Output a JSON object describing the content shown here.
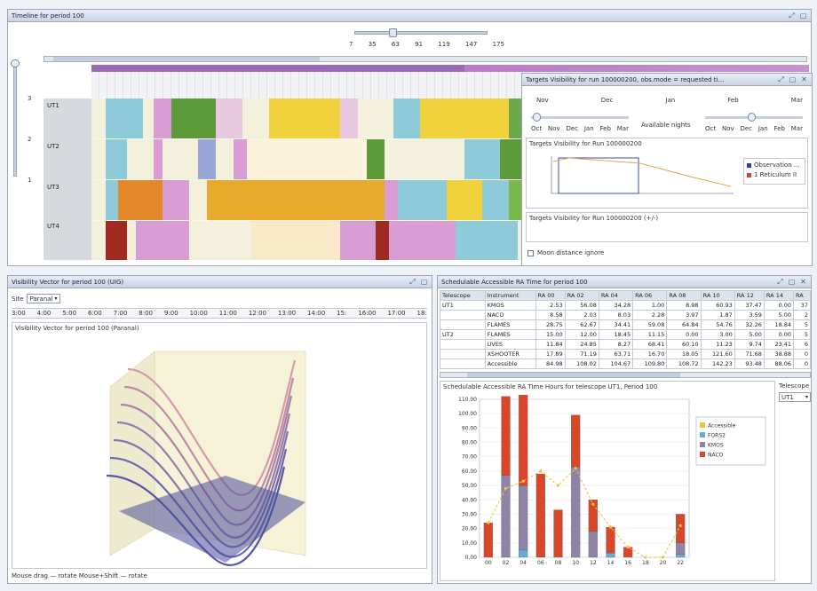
{
  "timeline": {
    "title": "Timeline for period 100",
    "slider_ticks": [
      "7",
      "35",
      "63",
      "91",
      "119",
      "147",
      "175"
    ],
    "telescopes": [
      "UT1",
      "UT2",
      "UT3",
      "UT4"
    ],
    "row_numbers": [
      "3",
      "2",
      "1"
    ]
  },
  "targets": {
    "title": "Targets Visibility for run 100000200, obs.mode = requested ti...",
    "months": [
      "Nov",
      "Dec",
      "Jan",
      "Feb",
      "Mar"
    ],
    "left_scale": [
      "Oct",
      "Nov",
      "Dec",
      "Jan",
      "Feb",
      "Mar"
    ],
    "right_scale": [
      "Oct",
      "Nov",
      "Dec",
      "Jan",
      "Feb",
      "Mar"
    ],
    "center_label": "Available nights",
    "chart_title": "Targets Visibility for Run 100000200",
    "legend": [
      "Observation ...",
      "1 Reticulum II"
    ],
    "subtitle": "Targets Visibility for Run 100000200 (+/-)",
    "checkbox_label": "Moon distance ignore"
  },
  "visibility": {
    "title": "Visibility Vector for period 100 (UIG)",
    "site_label": "Site",
    "site_value": "Paranal",
    "hour_ticks": [
      "3:00",
      "4:00",
      "5:00",
      "6:00",
      "7:00",
      "8:00",
      "9:00",
      "10:00",
      "11:00",
      "12:00",
      "13:00",
      "14:00",
      "15:",
      "16:00",
      "17:00",
      "18:"
    ],
    "plot_title": "Visibility Vector for period 100 (Paranal)",
    "status": "Mouse drag — rotate  Mouse+Shift — rotate"
  },
  "schedulable": {
    "title": "Schedulable Accessible RA Time for period 100",
    "columns": [
      "Telescope",
      "Instrument",
      "RA 00",
      "RA 02",
      "RA 04",
      "RA 06",
      "RA 08",
      "RA 10",
      "RA 12",
      "RA 14",
      "RA"
    ],
    "rows": [
      {
        "tel": "UT1",
        "inst": "KMOS",
        "vals": [
          "2.53",
          "56.08",
          "34.28",
          "1.00",
          "8.98",
          "60.93",
          "37.47",
          "0.00",
          "37"
        ]
      },
      {
        "tel": "",
        "inst": "NACO",
        "vals": [
          "8.58",
          "2.03",
          "8.03",
          "2.28",
          "3.97",
          "1.87",
          "3.59",
          "5.00",
          "2"
        ]
      },
      {
        "tel": "",
        "inst": "FLAMES",
        "vals": [
          "28.75",
          "62.67",
          "34.41",
          "59.08",
          "64.84",
          "54.76",
          "32.26",
          "18.84",
          "5"
        ]
      },
      {
        "tel": "UT2",
        "inst": "FLAMES",
        "vals": [
          "15.00",
          "12.00",
          "18.45",
          "11.15",
          "0.00",
          "3.00",
          "5.00",
          "0.00",
          "5"
        ]
      },
      {
        "tel": "",
        "inst": "UVES",
        "vals": [
          "11.84",
          "24.85",
          "8.27",
          "68.41",
          "60.10",
          "11.23",
          "9.74",
          "23.41",
          "6"
        ]
      },
      {
        "tel": "",
        "inst": "XSHOOTER",
        "vals": [
          "17.89",
          "71.19",
          "63.71",
          "16.70",
          "18.05",
          "121.60",
          "71.68",
          "38.88",
          "0"
        ]
      },
      {
        "tel": "",
        "inst": "Accessible",
        "vals": [
          "84.98",
          "108.02",
          "104.67",
          "109.80",
          "108.72",
          "142.23",
          "93.48",
          "88.06",
          "0"
        ]
      }
    ],
    "chart_title": "Schedulable Accessible RA Time Hours for telescope UT1, Period 100",
    "telescope_label": "Telescope",
    "telescope_value": "UT1"
  },
  "chart_data": {
    "type": "bar",
    "title": "Schedulable Accessible RA Time Hours for telescope UT1, Period 100",
    "categories": [
      "00",
      "02",
      "04",
      "06",
      "08",
      "10",
      "12",
      "14",
      "16",
      "18",
      "20",
      "22"
    ],
    "ylim": [
      0,
      110
    ],
    "yticks": [
      "0.00",
      "10.00",
      "20.00",
      "30.00",
      "40.00",
      "50.00",
      "60.00",
      "70.00",
      "80.00",
      "90.00",
      "100.00",
      "110.00"
    ],
    "series": [
      {
        "name": "FORS2",
        "color": "#6aaad8",
        "values": [
          0,
          0,
          5,
          0,
          0,
          0,
          0,
          3,
          0,
          0,
          0,
          2
        ]
      },
      {
        "name": "KMOS",
        "color": "#8f84a8",
        "values": [
          0,
          57,
          45,
          0,
          0,
          63,
          18,
          0,
          0,
          0,
          0,
          8
        ]
      },
      {
        "name": "NACO",
        "color": "#d9472b",
        "values": [
          24,
          55,
          63,
          58,
          33,
          36,
          22,
          18,
          7,
          0,
          0,
          20
        ]
      }
    ],
    "accessible": {
      "name": "Accessible",
      "color": "#f2c33a",
      "values": [
        24,
        48,
        53,
        60,
        50,
        62,
        37,
        21,
        7,
        0,
        0,
        22
      ]
    }
  }
}
